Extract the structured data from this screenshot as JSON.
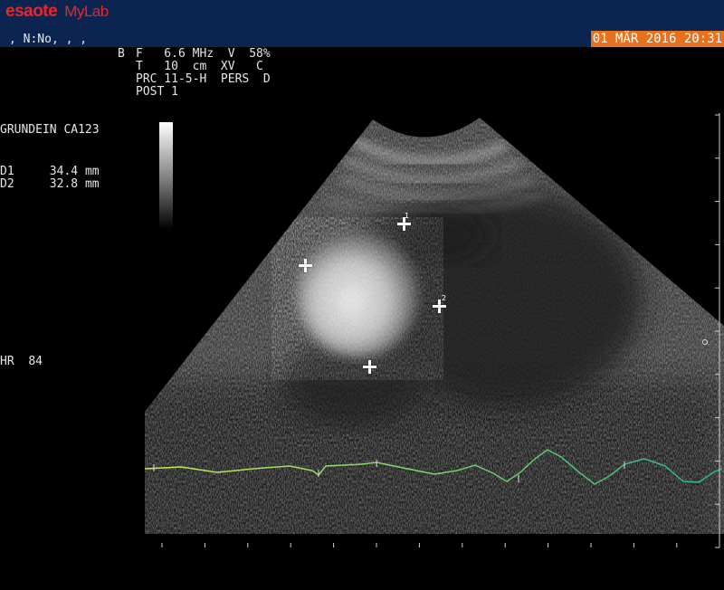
{
  "header": {
    "brand": "esaote",
    "product": "MyLab",
    "patient": ", N:No, , ,",
    "datetime": "01 MÄR 2016 20:31"
  },
  "params": {
    "mode": "B",
    "line1": "F   6.6 MHz  V  58%",
    "line2": "T   10  cm  XV   C",
    "line3": "PRC 11-5-H  PERS  D",
    "line4": "POST 1"
  },
  "annotation": "GRUNDEIN CA123",
  "measurements": [
    {
      "label": "D1",
      "value": "34.4",
      "unit": "mm"
    },
    {
      "label": "D2",
      "value": "32.8",
      "unit": "mm"
    }
  ],
  "heart_rate": {
    "label": "HR",
    "value": "84"
  },
  "calipers": [
    {
      "name": "1",
      "marker": "1"
    },
    {
      "name": "2",
      "marker": "2"
    }
  ],
  "colors": {
    "header_bg": "#0c2550",
    "brand": "#e8262b",
    "date_bg": "#e8711d",
    "ecg_start": "#c7ef4b",
    "ecg_end": "#2bb58a"
  }
}
